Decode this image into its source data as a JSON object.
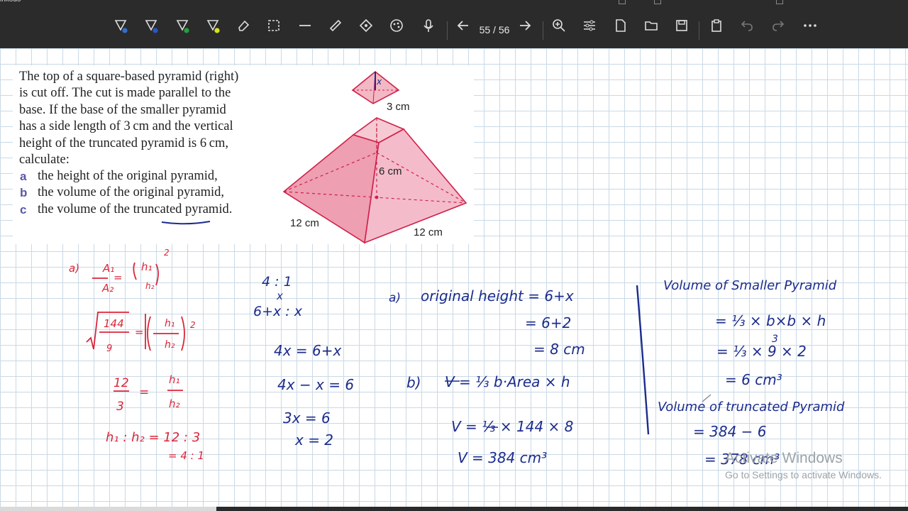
{
  "app": {
    "name": "inkodo"
  },
  "toolbar": {
    "page_indicator": "55 / 56"
  },
  "colors": {
    "toolbar_bg": "#2b2b2b",
    "grid": "#c9d9e6",
    "ink_red": "#d9263a",
    "ink_blue": "#1c2c8c",
    "pyramid_fill": "#f2b8c4",
    "pyramid_edge": "#d0204a"
  },
  "question": {
    "lines": [
      "The top of a square-based pyramid (right)",
      "is cut off. The cut is made parallel to the",
      "base. If the base of the smaller pyramid",
      "has a side length of 3 cm and the vertical",
      "height of the truncated pyramid is 6 cm,",
      "calculate:"
    ],
    "parts": [
      {
        "letter": "a",
        "text": "the height of the original pyramid,"
      },
      {
        "letter": "b",
        "text": "the volume of the original pyramid,"
      },
      {
        "letter": "c",
        "text": "the volume of the truncated pyramid."
      }
    ]
  },
  "diagram": {
    "small_side": "3 cm",
    "height": "6 cm",
    "base_left": "12 cm",
    "base_right": "12 cm",
    "small_height_mark": "x"
  },
  "notes_red": {
    "part_label": "a)",
    "ratio_top": "A₁",
    "ratio_bottom": "A₂",
    "h_top": "h₁",
    "h_bottom": "h₂",
    "exp": "2",
    "sqrt_top": "144",
    "sqrt_bottom": "9",
    "exp2": "2",
    "frac_top": "12",
    "frac_bottom": "3",
    "ratio_line": "h₁ : h₂ = 12 : 3",
    "ratio_line2": "= 4 : 1"
  },
  "notes_blue_mid": {
    "l1": "4 : 1",
    "l2": "x",
    "l3": "6+x : x",
    "l4": "4x = 6+x",
    "l5": "4x − x = 6",
    "l6": "3x = 6",
    "l7": "x = 2"
  },
  "notes_blue_right": {
    "a_label": "a)",
    "a_text": "original height = 6+x",
    "a_l2": "= 6+2",
    "a_l3": "= 8 cm",
    "b_label": "b)",
    "b_text": "V = ⅓ b·Area × h",
    "b_l2": "V = ⅓ × 144 × 8",
    "b_l3": "V = 384 cm³"
  },
  "notes_blue_far": {
    "t1": "Volume of Smaller Pyramid",
    "l1": "= ⅓ × b×b × h",
    "l2": "= ⅓ × 9 × 2",
    "l2_sup": "3",
    "l3": "= 6 cm³",
    "t2": "Volume of truncated Pyramid",
    "l4": "= 384 − 6",
    "l5": "= 378 cm³"
  },
  "watermark": {
    "line1": "Activate Windows",
    "line2": "Go to Settings to activate Windows."
  }
}
